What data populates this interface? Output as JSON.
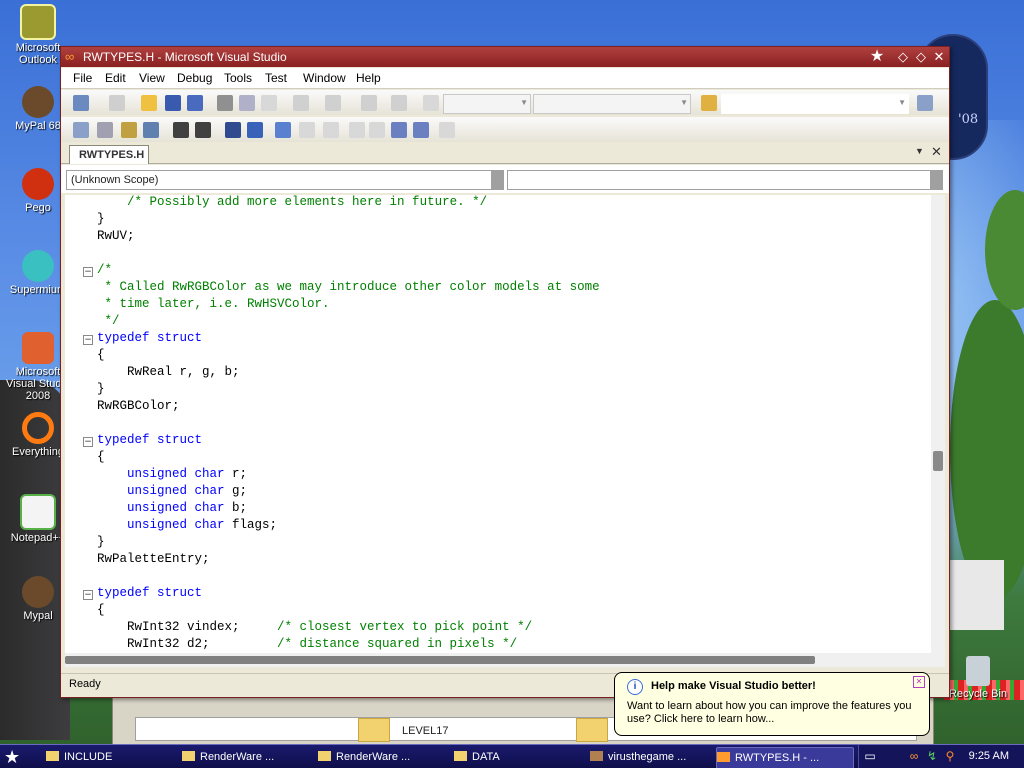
{
  "desktop": {
    "icons": [
      {
        "label": "Microsoft Outlook",
        "icon": "outlook-icon",
        "color": "#9a9a30"
      },
      {
        "label": "MyPal 68",
        "icon": "raccoon-icon",
        "color": "#6a4a2a"
      },
      {
        "label": "Pego",
        "icon": "red-ball-icon",
        "color": "#d03010"
      },
      {
        "label": "Supermium",
        "icon": "browser-icon",
        "color": "#3ac0c0"
      },
      {
        "label": "Microsoft Visual Studio 2008",
        "icon": "visual-studio-icon",
        "color": "#e06030"
      },
      {
        "label": "Everything",
        "icon": "search-ring-icon",
        "color": "#ff7a10"
      },
      {
        "label": "Notepad++",
        "icon": "notepadpp-icon",
        "color": "#58b048"
      },
      {
        "label": "Mypal",
        "icon": "raccoon-icon",
        "color": "#6a4a2a"
      }
    ],
    "wallpaper_badge": "'08",
    "recycle_bin_label": "Recycle Bin",
    "bg_window_folder": "LEVEL17"
  },
  "window": {
    "title": "RWTYPES.H - Microsoft Visual Studio",
    "menu": [
      "File",
      "Edit",
      "View",
      "Debug",
      "Tools",
      "Test",
      "Window",
      "Help"
    ],
    "tab_label": "RWTYPES.H",
    "scope": "(Unknown Scope)",
    "status": "Ready"
  },
  "code": {
    "lines": [
      [
        {
          "t": "    "
        },
        {
          "t": "/* Possibly add more elements here in future. */",
          "c": "cm"
        }
      ],
      [
        {
          "t": "}"
        }
      ],
      [
        {
          "t": "RwUV;"
        }
      ],
      [
        {
          "t": ""
        }
      ],
      [
        {
          "t": "/*",
          "c": "cm"
        }
      ],
      [
        {
          "t": " * Called RwRGBColor as we may introduce other color models at some",
          "c": "cm"
        }
      ],
      [
        {
          "t": " * time later, i.e. RwHSVColor.",
          "c": "cm"
        }
      ],
      [
        {
          "t": " */",
          "c": "cm"
        }
      ],
      [
        {
          "t": "typedef struct",
          "c": "kw"
        }
      ],
      [
        {
          "t": "{"
        }
      ],
      [
        {
          "t": "    RwReal r, g, b;"
        }
      ],
      [
        {
          "t": "}"
        }
      ],
      [
        {
          "t": "RwRGBColor;"
        }
      ],
      [
        {
          "t": ""
        }
      ],
      [
        {
          "t": "typedef struct",
          "c": "kw"
        }
      ],
      [
        {
          "t": "{"
        }
      ],
      [
        {
          "t": "    "
        },
        {
          "t": "unsigned char",
          "c": "kw"
        },
        {
          "t": " r;"
        }
      ],
      [
        {
          "t": "    "
        },
        {
          "t": "unsigned char",
          "c": "kw"
        },
        {
          "t": " g;"
        }
      ],
      [
        {
          "t": "    "
        },
        {
          "t": "unsigned char",
          "c": "kw"
        },
        {
          "t": " b;"
        }
      ],
      [
        {
          "t": "    "
        },
        {
          "t": "unsigned char",
          "c": "kw"
        },
        {
          "t": " flags;"
        }
      ],
      [
        {
          "t": "}"
        }
      ],
      [
        {
          "t": "RwPaletteEntry;"
        }
      ],
      [
        {
          "t": ""
        }
      ],
      [
        {
          "t": "typedef struct",
          "c": "kw"
        }
      ],
      [
        {
          "t": "{"
        }
      ],
      [
        {
          "t": "    RwInt32 vindex;     "
        },
        {
          "t": "/* closest vertex to pick point */",
          "c": "cm"
        }
      ],
      [
        {
          "t": "    RwInt32 d2;         "
        },
        {
          "t": "/* distance squared in pixels */",
          "c": "cm"
        }
      ]
    ],
    "fold_rows": [
      4,
      8,
      14,
      23
    ]
  },
  "balloon": {
    "title": "Help make Visual Studio better!",
    "body": "Want to learn about how you can improve the features you use? Click here to learn how..."
  },
  "taskbar": {
    "items": [
      "INCLUDE",
      "RenderWare ...",
      "RenderWare ...",
      "DATA",
      "virusthegame ...",
      "RWTYPES.H - ..."
    ],
    "clock": "9:25 AM"
  }
}
